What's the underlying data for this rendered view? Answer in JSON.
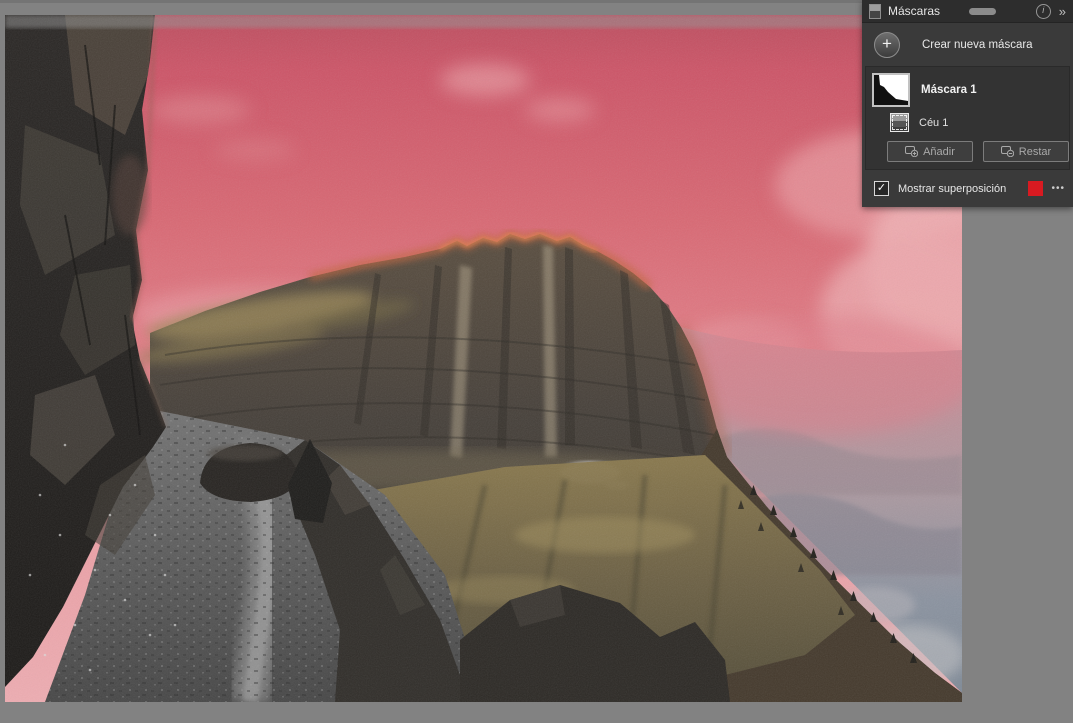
{
  "panel": {
    "title": "Máscaras",
    "create_mask": {
      "label": "Crear nueva máscara"
    },
    "masks": [
      {
        "name": "Máscara 1",
        "components": [
          {
            "name": "Céu 1"
          }
        ]
      }
    ],
    "buttons": {
      "add": "Añadir",
      "subtract": "Restar"
    },
    "overlay": {
      "label": "Mostrar superposición",
      "checked": true,
      "color": "#d81a21"
    }
  },
  "glyphs": {
    "plus": "+",
    "check": "✓",
    "ellipsis": "•••",
    "chevrons": "»",
    "info": "i"
  },
  "photo": {
    "mask_overlay_color": "#dd6e7c"
  }
}
